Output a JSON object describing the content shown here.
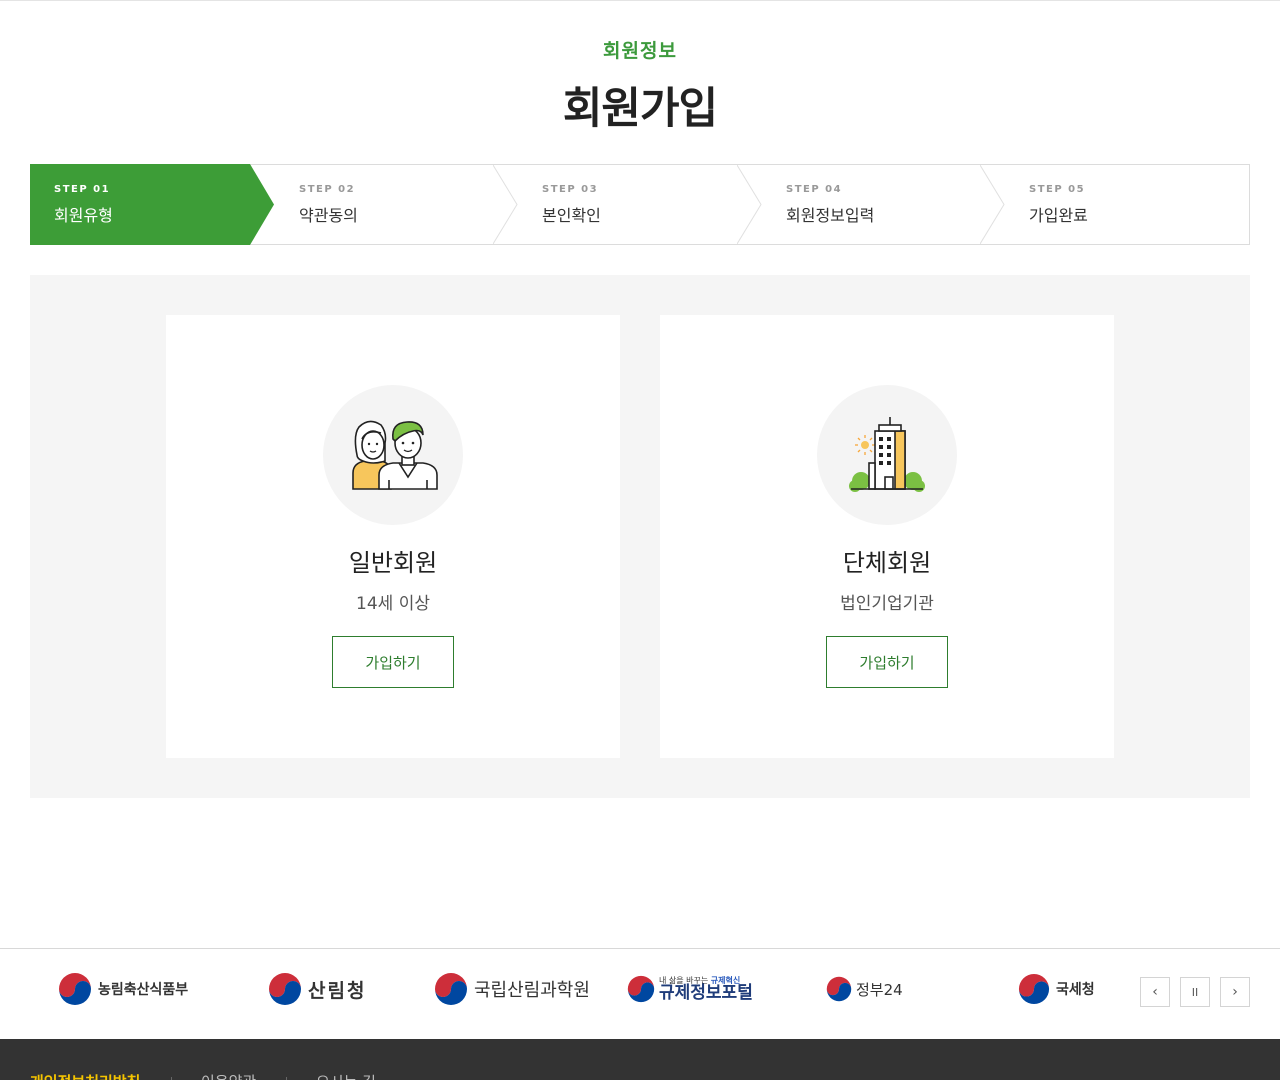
{
  "header": {
    "subtitle": "회원정보",
    "title": "회원가입"
  },
  "steps": [
    {
      "no": "STEP 01",
      "label": "회원유형",
      "active": true
    },
    {
      "no": "STEP 02",
      "label": "약관동의",
      "active": false
    },
    {
      "no": "STEP 03",
      "label": "본인확인",
      "active": false
    },
    {
      "no": "STEP 04",
      "label": "회원정보입력",
      "active": false
    },
    {
      "no": "STEP 05",
      "label": "가입완료",
      "active": false
    }
  ],
  "cards": [
    {
      "icon": "people-icon",
      "title": "일반회원",
      "desc": "14세 이상",
      "button": "가입하기"
    },
    {
      "icon": "building-icon",
      "title": "단체회원",
      "desc": "법인기업기관",
      "button": "가입하기"
    }
  ],
  "banner": {
    "logos": [
      {
        "name": "농림축산식품부"
      },
      {
        "name": "산림청"
      },
      {
        "name": "국립산림과학원"
      },
      {
        "name": "규제정보포털",
        "tagline_prefix": "내 삶을 바꾸는 ",
        "tagline_highlight": "규제혁신"
      },
      {
        "name": "정부24"
      },
      {
        "name": "국세청"
      }
    ],
    "controls": {
      "prev": "‹",
      "pause": "II",
      "next": "›"
    }
  },
  "footer": {
    "links": [
      "개인정보처리방침",
      "이용약관",
      "오시는 길"
    ]
  },
  "colors": {
    "accent_green": "#3c9a3c",
    "active_step_bg": "#3d9d37",
    "button_border": "#2e7d2e",
    "panel_bg": "#f5f5f5",
    "footer_bg": "#333333",
    "footer_highlight": "#f4c400"
  }
}
